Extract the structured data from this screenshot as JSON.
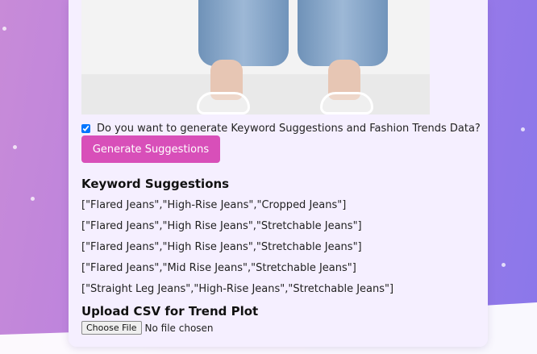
{
  "checkbox": {
    "label": "Do you want to generate Keyword Suggestions and Fashion Trends Data?",
    "checked": true
  },
  "generate_button": {
    "label": "Generate Suggestions",
    "color": "#d84fb9"
  },
  "keywords": {
    "heading": "Keyword Suggestions",
    "items": [
      "[\"Flared Jeans\",\"High-Rise Jeans\",\"Cropped Jeans\"]",
      "[\"Flared Jeans\",\"High Rise Jeans\",\"Stretchable Jeans\"]",
      "[\"Flared Jeans\",\"High Rise Jeans\",\"Stretchable Jeans\"]",
      "[\"Flared Jeans\",\"Mid Rise Jeans\",\"Stretchable Jeans\"]",
      "[\"Straight Leg Jeans\",\"High-Rise Jeans\",\"Stretchable Jeans\"]"
    ]
  },
  "upload": {
    "heading": "Upload CSV for Trend Plot",
    "button_label": "Choose File",
    "status": "No file chosen"
  }
}
